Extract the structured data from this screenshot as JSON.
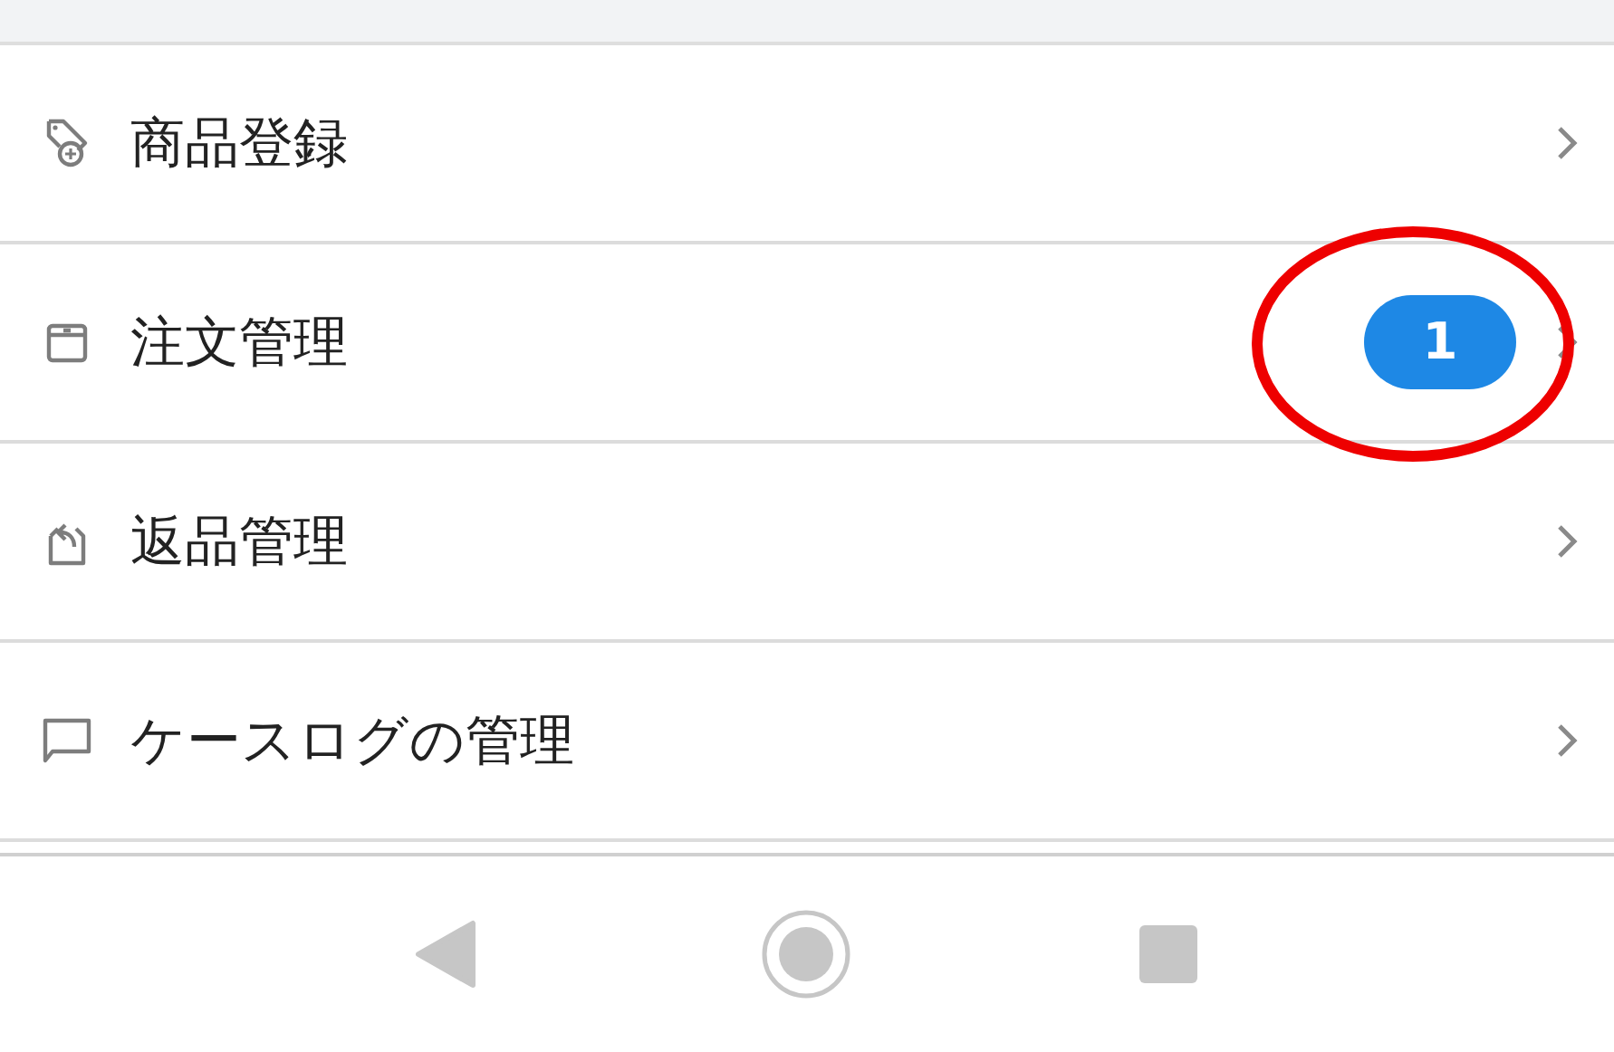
{
  "menu": [
    {
      "label": "商品登録"
    },
    {
      "label": "注文管理",
      "badge": "1"
    },
    {
      "label": "返品管理"
    },
    {
      "label": "ケースログの管理"
    }
  ]
}
